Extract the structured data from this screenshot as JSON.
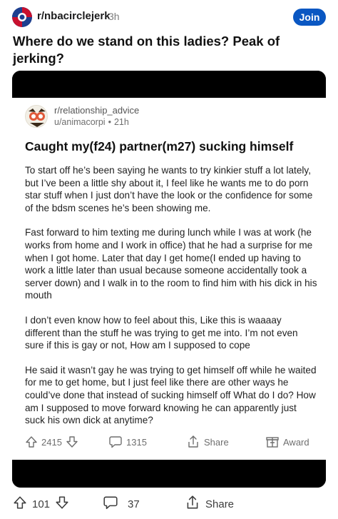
{
  "outer": {
    "subreddit": "r/nbacirclejerk",
    "age": "3h",
    "join_label": "Join",
    "title": "Where do we stand on this ladies? Peak of jerking?",
    "upvotes": "101",
    "comments": "37",
    "share_label": "Share"
  },
  "embedded": {
    "subreddit": "r/relationship_advice",
    "user": "u/animacorpi",
    "separator": "•",
    "age": "21h",
    "title": "Caught my(f24) partner(m27) sucking himself",
    "paragraphs": [
      "To start off he’s been saying he wants to try kinkier stuff a lot lately, but I’ve been a little shy about it, I feel like he wants me to do porn star stuff when I just don’t have the look or the confidence for some of the bdsm scenes he’s been showing me.",
      "Fast forward to him texting me during lunch while I was at work (he works from home and I work in office) that he had a surprise for me when I got home. Later that day I get home(I ended up having to work a little later than usual because someone accidentally took a server down) and I walk in to the room to find him with his dick in his mouth",
      "I don’t even know how to feel about this, Like this is waaaay different than the stuff he was trying to get me into. I’m not even sure if this is gay or not, How am I supposed to cope",
      "He said it wasn’t gay he was trying to get himself off while he waited for me to get home, but I just feel like there are other ways he could’ve done that instead of sucking himself off What do I do? How am I supposed to move forward knowing he can apparently just suck his own dick at anytime?"
    ],
    "upvotes": "2415",
    "comments": "1315",
    "share_label": "Share",
    "award_label": "Award"
  },
  "colors": {
    "join_button": "#0a57c2",
    "text_primary": "#1a1a1b",
    "text_muted": "#6e6e6e",
    "embed_frame": "#000000"
  },
  "icons": {
    "outer_avatar": "nba-subreddit-avatar-icon",
    "inner_avatar": "relationship-advice-avatar-icon",
    "upvote": "upvote-arrow-icon",
    "downvote": "downvote-arrow-icon",
    "comment": "comment-bubble-icon",
    "share": "share-icon",
    "award": "award-icon"
  }
}
